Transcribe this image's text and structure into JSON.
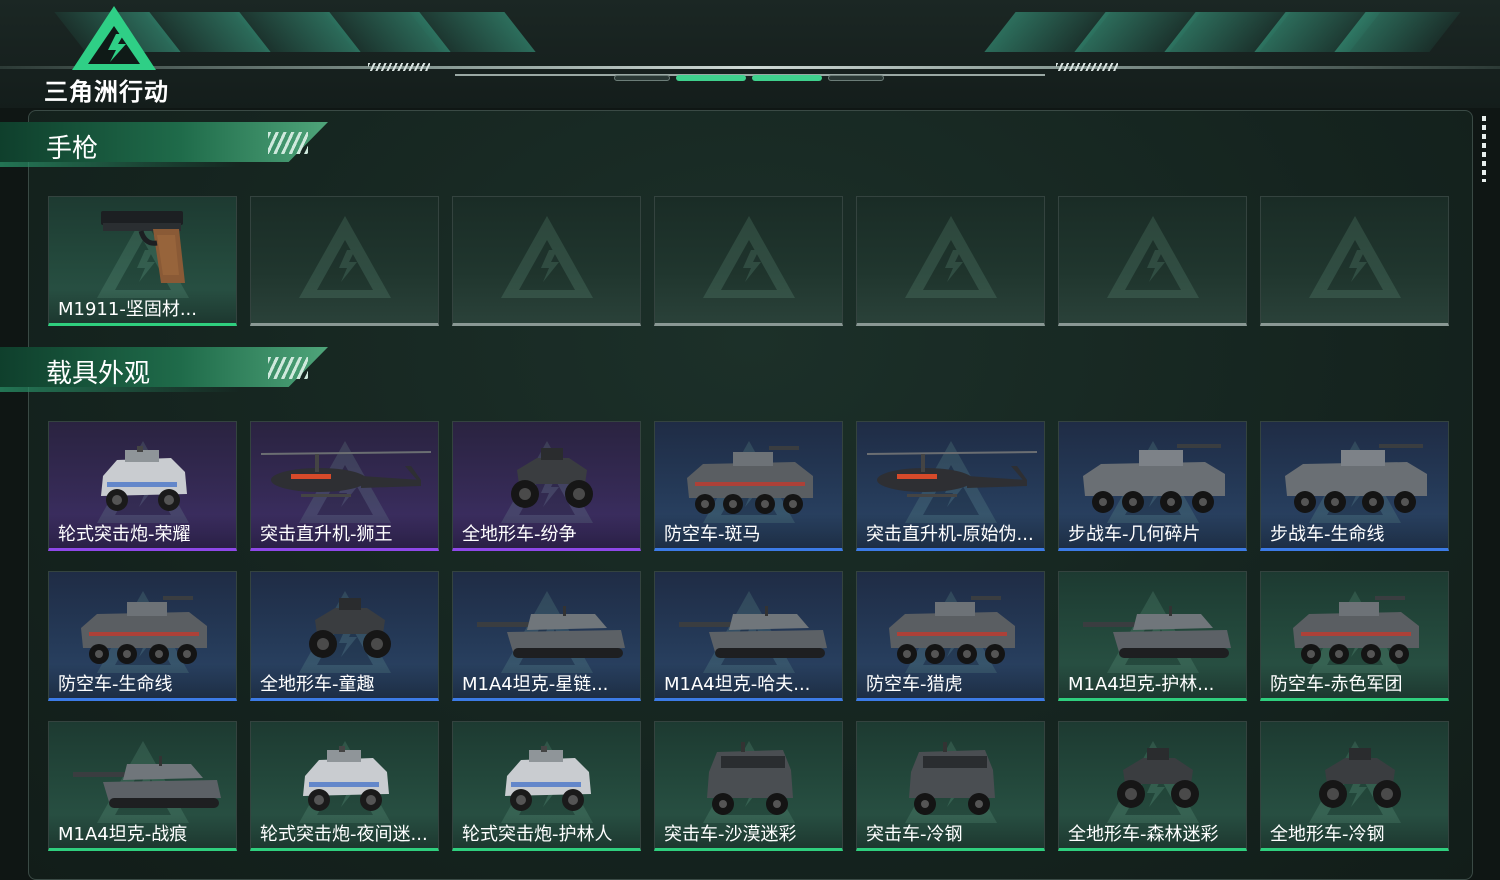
{
  "app": {
    "logo_text": "三角洲行动",
    "logo_icon": "delta-triangle-icon"
  },
  "sections": [
    {
      "title": "手枪",
      "items": [
        {
          "name": "M1911-坚固材...",
          "rarity": "green",
          "icon": "pistol-icon"
        },
        {
          "name": "",
          "rarity": "empty",
          "icon": "delta-watermark-icon"
        },
        {
          "name": "",
          "rarity": "empty",
          "icon": "delta-watermark-icon"
        },
        {
          "name": "",
          "rarity": "empty",
          "icon": "delta-watermark-icon"
        },
        {
          "name": "",
          "rarity": "empty",
          "icon": "delta-watermark-icon"
        },
        {
          "name": "",
          "rarity": "empty",
          "icon": "delta-watermark-icon"
        },
        {
          "name": "",
          "rarity": "empty",
          "icon": "delta-watermark-icon"
        }
      ]
    },
    {
      "title": "载具外观",
      "items": [
        {
          "name": "轮式突击炮-荣耀",
          "rarity": "purple",
          "icon": "wheeled-vehicle-icon"
        },
        {
          "name": "突击直升机-狮王",
          "rarity": "purple",
          "icon": "helicopter-icon"
        },
        {
          "name": "全地形车-纷争",
          "rarity": "purple",
          "icon": "atv-icon"
        },
        {
          "name": "防空车-斑马",
          "rarity": "blue",
          "icon": "armored-car-icon"
        },
        {
          "name": "突击直升机-原始伪...",
          "rarity": "blue",
          "icon": "helicopter-icon"
        },
        {
          "name": "步战车-几何碎片",
          "rarity": "blue",
          "icon": "ifv-icon"
        },
        {
          "name": "步战车-生命线",
          "rarity": "blue",
          "icon": "ifv-icon"
        },
        {
          "name": "防空车-生命线",
          "rarity": "blue",
          "icon": "armored-car-icon"
        },
        {
          "name": "全地形车-童趣",
          "rarity": "blue",
          "icon": "atv-icon"
        },
        {
          "name": "M1A4坦克-星链...",
          "rarity": "blue",
          "icon": "tank-icon"
        },
        {
          "name": "M1A4坦克-哈夫...",
          "rarity": "blue",
          "icon": "tank-icon"
        },
        {
          "name": "防空车-猎虎",
          "rarity": "blue",
          "icon": "armored-car-icon"
        },
        {
          "name": "M1A4坦克-护林...",
          "rarity": "green",
          "icon": "tank-icon"
        },
        {
          "name": "防空车-赤色军团",
          "rarity": "green",
          "icon": "armored-car-icon"
        },
        {
          "name": "M1A4坦克-战痕",
          "rarity": "green",
          "icon": "tank-icon"
        },
        {
          "name": "轮式突击炮-夜间迷...",
          "rarity": "green",
          "icon": "wheeled-vehicle-icon"
        },
        {
          "name": "轮式突击炮-护林人",
          "rarity": "green",
          "icon": "wheeled-vehicle-icon"
        },
        {
          "name": "突击车-沙漠迷彩",
          "rarity": "green",
          "icon": "suv-icon"
        },
        {
          "name": "突击车-冷钢",
          "rarity": "green",
          "icon": "suv-icon"
        },
        {
          "name": "全地形车-森林迷彩",
          "rarity": "green",
          "icon": "atv-icon"
        },
        {
          "name": "全地形车-冷钢",
          "rarity": "green",
          "icon": "atv-icon"
        }
      ]
    }
  ],
  "colors": {
    "green": "#2fcf7e",
    "blue": "#3c7be6",
    "purple": "#8e48e8",
    "empty": "#8a9894",
    "accent": "#2fbf7e"
  },
  "scrollbar": {
    "icon": "scroll-dots-icon"
  }
}
